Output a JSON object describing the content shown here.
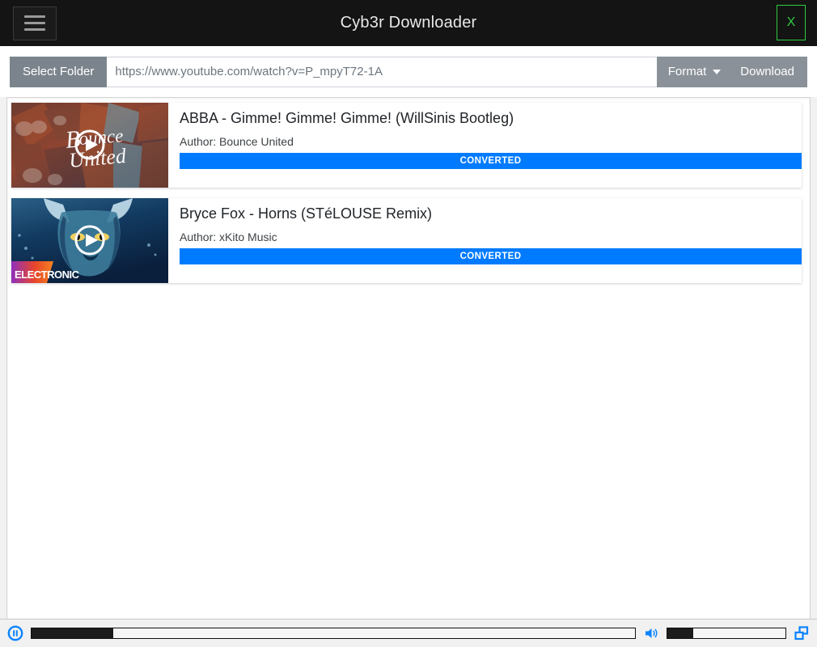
{
  "titlebar": {
    "menu_icon": "hamburger-menu-icon",
    "title": "Cyb3r Downloader",
    "close_label": "X",
    "accent_close": "#2ecc40",
    "background": "#141414"
  },
  "toolbar": {
    "select_folder_label": "Select Folder",
    "url_value": "https://www.youtube.com/watch?v=P_mpyT72-1A",
    "url_placeholder": "https://www.youtube.com/watch?v=P_mpyT72-1A",
    "format_label": "Format",
    "format_caret_icon": "chevron-down-icon",
    "download_label": "Download",
    "button_color": "#7b848c"
  },
  "list": {
    "items": [
      {
        "title": "ABBA - Gimme! Gimme! Gimme! (WillSinis Bootleg)",
        "author": "Author: Bounce United",
        "status": "CONVERTED",
        "progress_percent": 100,
        "thumbnail_label": "Bounce United",
        "thumbnail_badge": "",
        "play_icon": "play-circle-icon"
      },
      {
        "title": "Bryce Fox - Horns (STéLOUSE Remix)",
        "author": "Author: xKito Music",
        "status": "CONVERTED",
        "progress_percent": 100,
        "thumbnail_label": "",
        "thumbnail_badge": "ELECTRONIC",
        "play_icon": "play-circle-icon"
      }
    ],
    "progress_color": "#007bff"
  },
  "player": {
    "play_pause_icon": "pause-circle-icon",
    "seek_percent": 13.5,
    "volume_icon": "speaker-volume-icon",
    "volume_percent": 22,
    "windowed_icon": "picture-in-picture-icon",
    "accent": "#0a84ff"
  }
}
